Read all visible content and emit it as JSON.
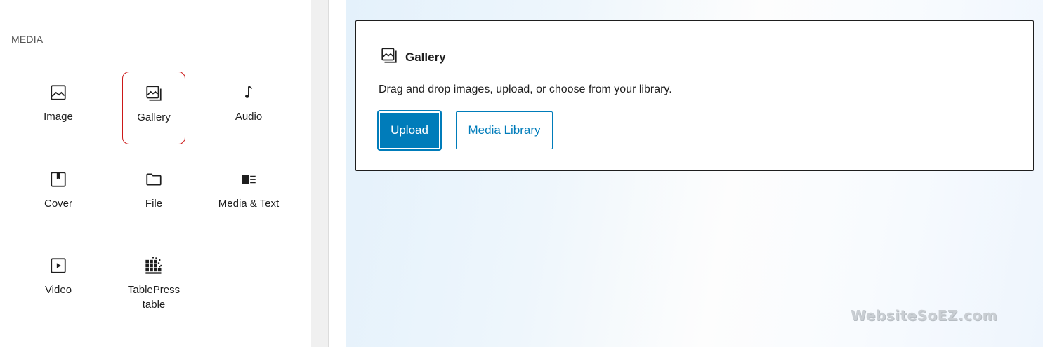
{
  "inserter": {
    "section_title": "MEDIA",
    "blocks": [
      {
        "label": "Image",
        "icon": "image-icon"
      },
      {
        "label": "Gallery",
        "icon": "gallery-icon",
        "selected": true
      },
      {
        "label": "Audio",
        "icon": "audio-icon"
      },
      {
        "label": "Cover",
        "icon": "cover-icon"
      },
      {
        "label": "File",
        "icon": "file-icon"
      },
      {
        "label": "Media & Text",
        "icon": "media-text-icon"
      },
      {
        "label": "Video",
        "icon": "video-icon"
      },
      {
        "label": "TablePress table",
        "icon": "tablepress-icon"
      }
    ]
  },
  "gallery_block": {
    "title": "Gallery",
    "instructions": "Drag and drop images, upload, or choose from your library.",
    "upload_label": "Upload",
    "library_label": "Media Library"
  },
  "watermark": "WebsiteSoEZ.com",
  "colors": {
    "accent": "#007cba",
    "selection_border": "#cc1818"
  }
}
